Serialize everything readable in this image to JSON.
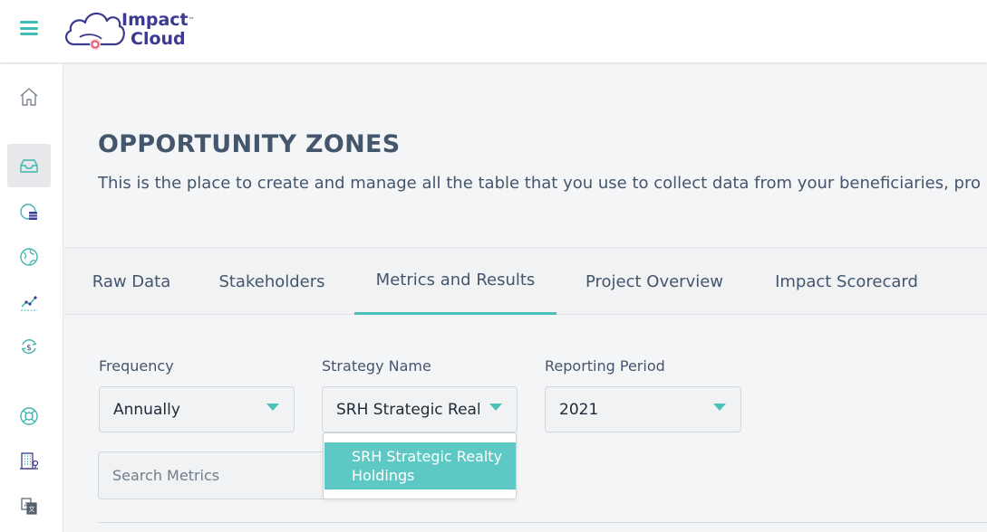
{
  "brand": {
    "name_line1": "Impact",
    "trademark": "™",
    "name_line2": "Cloud",
    "colors": {
      "primary": "#3b3a8f",
      "accent": "#4cbfb8",
      "logo_dot": "#e2566f"
    }
  },
  "topbar": {
    "menu_icon": "hamburger-icon"
  },
  "sidebar": {
    "items": [
      {
        "icon": "home-icon",
        "active": false
      },
      {
        "icon": "inbox-icon",
        "active": true
      },
      {
        "icon": "database-chart-icon",
        "active": false
      },
      {
        "icon": "globe-icon",
        "active": false
      },
      {
        "icon": "trend-line-icon",
        "active": false
      },
      {
        "icon": "dollar-cycle-icon",
        "active": false
      },
      {
        "icon": "lifebuoy-icon",
        "active": false
      },
      {
        "icon": "building-icon",
        "active": false
      },
      {
        "icon": "translate-icon",
        "active": false
      }
    ]
  },
  "page": {
    "title": "OPPORTUNITY ZONES",
    "description": "This is the place to create and manage all the table that you use to collect data from your beneficiaries, pro"
  },
  "tabs": [
    {
      "label": "Raw Data",
      "active": false
    },
    {
      "label": "Stakeholders",
      "active": false
    },
    {
      "label": "Metrics and Results",
      "active": true
    },
    {
      "label": "Project Overview",
      "active": false
    },
    {
      "label": "Impact Scorecard",
      "active": false
    }
  ],
  "filters": {
    "frequency": {
      "label": "Frequency",
      "value": "Annually"
    },
    "strategy": {
      "label": "Strategy Name",
      "value": "SRH Strategic Realty Holdings",
      "options": [
        "SRH Strategic Realty Holdings"
      ]
    },
    "period": {
      "label": "Reporting Period",
      "value": "2021"
    }
  },
  "search": {
    "placeholder": "Search Metrics",
    "value": ""
  }
}
